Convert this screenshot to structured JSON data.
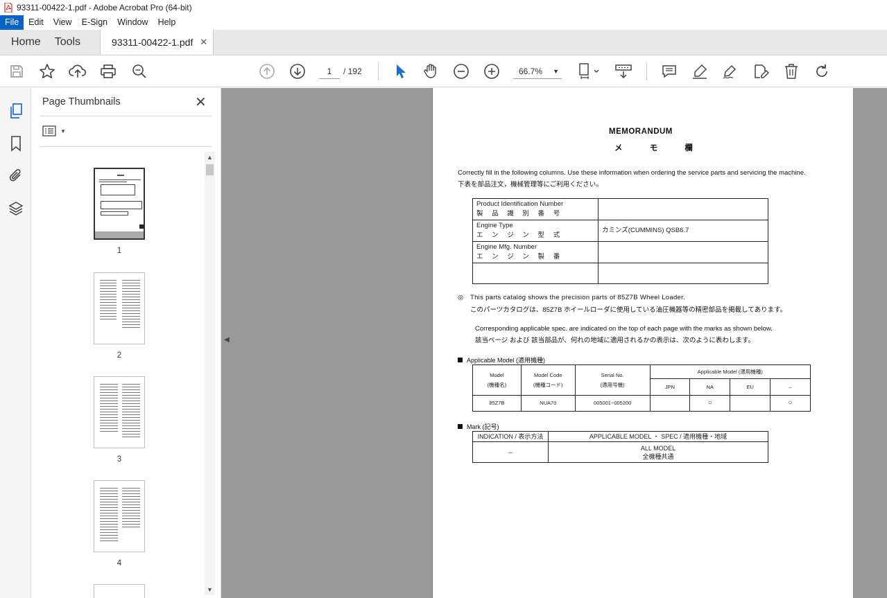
{
  "window": {
    "title": "93311-00422-1.pdf - Adobe Acrobat Pro (64-bit)"
  },
  "menu": [
    "File",
    "Edit",
    "View",
    "E-Sign",
    "Window",
    "Help"
  ],
  "tabs": {
    "home": "Home",
    "tools": "Tools",
    "document": "93311-00422-1.pdf"
  },
  "toolbar": {
    "page_current": "1",
    "page_total": "/ 192",
    "zoom": "66.7%"
  },
  "thumbnail_panel": {
    "title": "Page Thumbnails",
    "pages": [
      "1",
      "2",
      "3",
      "4"
    ]
  },
  "document": {
    "title_en": "MEMORANDUM",
    "title_jp": "メ モ 欄",
    "instruction_en": "Correctly fill in the following columns. Use these information when ordering the service parts and servicing the machine.",
    "instruction_jp": "下表を部品注文，機械管理等にご利用ください。",
    "id_table": [
      {
        "label_en": "Product Identification Number",
        "label_jp": "製 品 識 別 番 号",
        "value": ""
      },
      {
        "label_en": "Engine Type",
        "label_jp": "エ ン ジ ン 型 式",
        "value": "カミンズ(CUMMINS) QSB6.7"
      },
      {
        "label_en": "Engine Mfg. Number",
        "label_jp": "エ ン ジ ン 製 番",
        "value": ""
      },
      {
        "label_en": "",
        "label_jp": "",
        "value": ""
      }
    ],
    "note_symbol": "◎",
    "note_en": "This parts catalog shows the precision parts of 85Z7B Wheel Loader.",
    "note_jp": "このパーツカタログは、85Z7B ホイールローダに使用している油圧機器等の精密部品を掲載してあります。",
    "spec_en": "Corresponding applicable spec. are indicated on the top of each page with the marks as shown below.",
    "spec_jp": "該当ページ および 該当部品が、何れの地域に適用されるかの表示は、次のように表わします。",
    "applicable_model": {
      "heading": "Applicable Model (適用機種)",
      "col_model": "Model",
      "col_model_jp": "(機種名)",
      "col_code": "Model Code",
      "col_code_jp": "(機種コード)",
      "col_serial": "Serial No.",
      "col_serial_jp": "(適用号機)",
      "col_applicable": "Applicable Model (適用機種)",
      "regions": [
        "JPN",
        "NA",
        "EU",
        "–"
      ],
      "row": {
        "model": "85Z7B",
        "code": "NUA70",
        "serial": "005001~005200",
        "marks": [
          "",
          "○",
          "",
          "○"
        ]
      }
    },
    "mark": {
      "heading": "Mark (記号)",
      "col_indication": "INDICATION / 表示方法",
      "col_applicable": "APPLICABLE MODEL ・ SPEC / 適用機種・地域",
      "indication": "–",
      "applicable_en": "ALL MODEL",
      "applicable_jp": "全機種共通"
    }
  }
}
